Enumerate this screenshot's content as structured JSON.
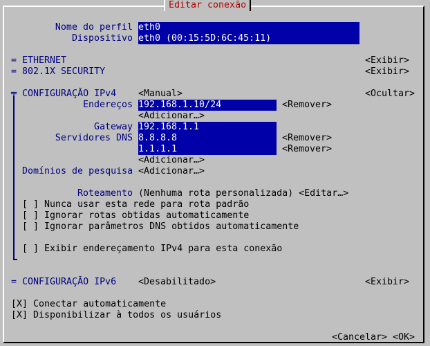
{
  "window": {
    "title": "Editar conexão"
  },
  "profile": {
    "name_label": "Nome do perfil",
    "name_value": "eth0",
    "device_label": "Dispositivo",
    "device_value": "eth0 (00:15:5D:6C:45:11)"
  },
  "sections": {
    "ethernet": {
      "label": "= ETHERNET",
      "toggle": "<Exibir>"
    },
    "security": {
      "label": "= 802.1X SECURITY",
      "toggle": "<Exibir>"
    },
    "ipv4": {
      "label": "╤ CONFIGURAÇÃO IPv4",
      "method": "<Manual>",
      "toggle": "<Ocultar>",
      "addresses_label": "Endereços",
      "address_value": "192.168.1.10/24",
      "remove_label": "<Remover>",
      "add_label": "<Adicionar…>",
      "gateway_label": "Gateway",
      "gateway_value": "192.168.1.1",
      "dns_label": "Servidores DNS",
      "dns": [
        "8.8.8.8",
        "1.1.1.1"
      ],
      "search_domains_label": "Domínios de pesquisa",
      "routing_label": "Roteamento",
      "routing_value": "(Nenhuma rota personalizada) <Editar…>",
      "options": [
        "[ ] Nunca usar esta rede para rota padrão",
        "[ ] Ignorar rotas obtidas automaticamente",
        "[ ] Ignorar parâmetros DNS obtidos automaticamente",
        "[ ] Exibir endereçamento IPv4 para esta conexão"
      ]
    },
    "ipv6": {
      "label": "= CONFIGURAÇÃO IPv6",
      "method": "<Desabilitado>",
      "toggle": "<Exibir>"
    }
  },
  "general": {
    "autoconnect": "[X] Conectar automaticamente",
    "all_users": "[X] Disponibilizar à todos os usuários"
  },
  "buttons": {
    "cancel": "<Cancelar>",
    "ok": "<OK>"
  }
}
